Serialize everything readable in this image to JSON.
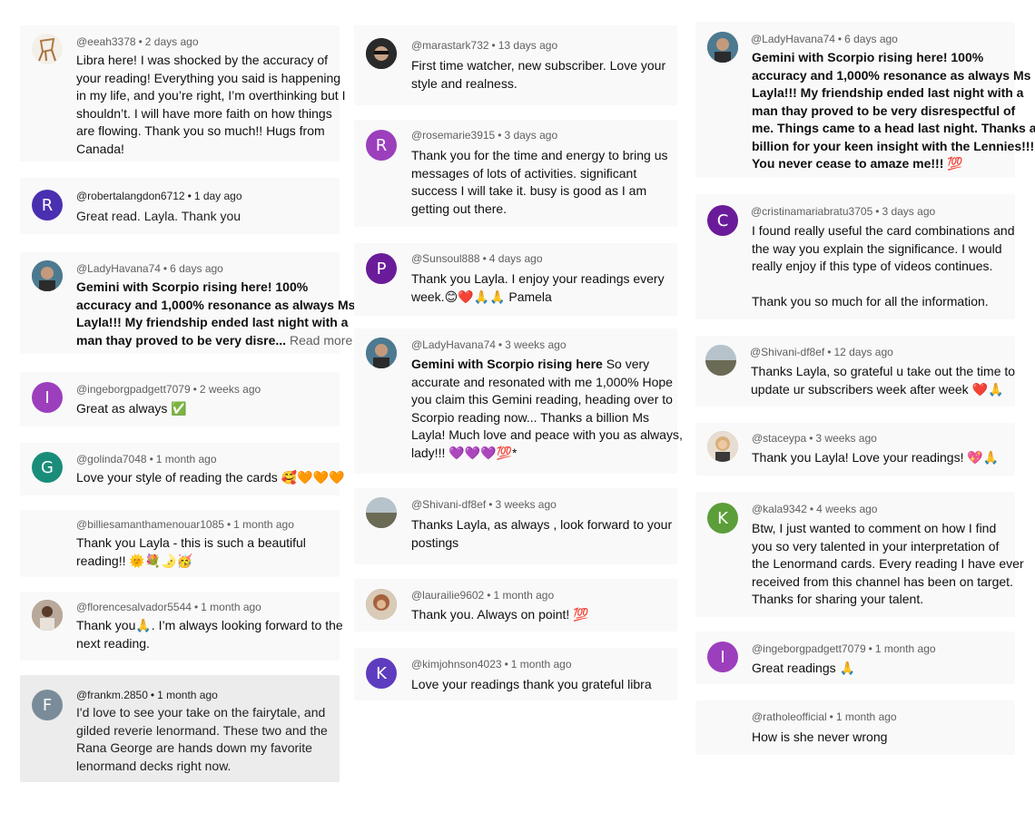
{
  "colors": {
    "purple": "#9c3fbd",
    "indigo": "#4a2fb0",
    "teal": "#1a8c7a",
    "green": "#5b9e3a",
    "slate": "#7a8c99",
    "meta": "#606060"
  },
  "comments": [
    {
      "user": "@eeah3378",
      "time": "2 days ago",
      "avatar": "chair-photo",
      "lines": [
        "Libra here! I was shocked by the accuracy of",
        "your reading! Everything you said is happening",
        "in my life, and you’re right, I’m overthinking but I",
        "shouldn’t. I will have more faith on how things",
        "are flowing. Thank you so much!! Hugs from",
        "Canada!"
      ]
    },
    {
      "user": "@robertalangdon6712",
      "time": "1 day ago",
      "avatar_letter": "R",
      "lines": [
        "Great read. Layla.  Thank you"
      ]
    },
    {
      "user": "@LadyHavana74",
      "time": "6 days ago",
      "avatar": "profile-photo",
      "lines": [
        "Gemini with Scorpio rising here! 100%",
        "accuracy and 1,000% resonance as always Ms",
        "Layla!!! My friendship ended last night with a",
        "man thay proved to be very disre..."
      ],
      "read_more": "Read more"
    },
    {
      "user": "@ingeborgpadgett7079",
      "time": "2 weeks ago",
      "avatar_letter": "I",
      "lines": [
        "Great as always ✅"
      ]
    },
    {
      "user": "@golinda7048",
      "time": "1 month ago",
      "avatar_letter": "G",
      "lines": [
        "Love your style of reading the cards 🥰🧡🧡🧡"
      ]
    },
    {
      "user": "@billiesamanthamenouar1085",
      "time": "1 month ago",
      "lines": [
        "Thank you Layla - this is such a beautiful",
        "reading!! 🌞💐🌛🥳"
      ]
    },
    {
      "user": "@florencesalvador5544",
      "time": "1 month ago",
      "avatar": "profile-photo",
      "lines": [
        "Thank you🙏. I’m always looking forward to the",
        "next reading."
      ]
    },
    {
      "user": "@frankm.2850",
      "time": "1 month ago",
      "avatar_letter": "F",
      "lines": [
        "I'd love to see your take on the fairytale, and",
        "gilded reverie lenormand. These two and the",
        "Rana George are hands down my favorite",
        "lenormand decks right now."
      ]
    },
    {
      "user": "@marastark732",
      "time": "13 days ago",
      "avatar": "profile-photo",
      "lines": [
        "First time watcher, new subscriber. Love your",
        "style and realness."
      ]
    },
    {
      "user": "@rosemarie3915",
      "time": "3 days ago",
      "avatar_letter": "R",
      "lines": [
        "Thank you for the time and energy to bring us",
        "messages of lots of activities.  significant",
        "success I will take it.  busy is good as I am",
        "getting out there."
      ]
    },
    {
      "user": "@Sunsoul888",
      "time": "4 days ago",
      "avatar_letter": "P",
      "lines": [
        "Thank you Layla. I enjoy your readings every",
        "week.😊❤️🙏🙏 Pamela"
      ]
    },
    {
      "user": "@LadyHavana74",
      "time": "3 weeks ago",
      "avatar": "profile-photo",
      "lead": "Gemini with Scorpio rising here",
      "lines": [
        " So very",
        "accurate and resonated with me 1,000% Hope",
        "you claim this Gemini reading, heading over to",
        "Scorpio reading now... Thanks a billion Ms",
        "Layla! Much love and peace with you as always,",
        "lady!!! 💜💜💜💯*"
      ]
    },
    {
      "user": "@Shivani-df8ef",
      "time": "3 weeks ago",
      "avatar": "landscape-photo",
      "lines": [
        "Thanks Layla, as always , look forward to your",
        "postings"
      ]
    },
    {
      "user": "@laurailie9602",
      "time": "1 month ago",
      "avatar": "profile-photo",
      "lines": [
        "Thank you. Always on point! 💯"
      ]
    },
    {
      "user": "@kimjohnson4023",
      "time": "1 month ago",
      "avatar_letter": "K",
      "lines": [
        "Love your readings thank you grateful libra"
      ]
    },
    {
      "user": "@LadyHavana74",
      "time": "6 days ago",
      "avatar": "profile-photo",
      "lines": [
        "Gemini with Scorpio rising here! 100%",
        "accuracy and 1,000% resonance as always Ms",
        "Layla!!! My friendship ended last night with a",
        "man thay proved to be very disrespectful of",
        "me. Things came to a head last night. Thanks a",
        "billion for your keen insight with the Lennies!!!",
        "You never cease to amaze me!!! 💯"
      ]
    },
    {
      "user": "@cristinamariabratu3705",
      "time": "3 days ago",
      "avatar_letter": "C",
      "lines": [
        "I found really useful the card combinations and",
        "the way you explain the significance. I would",
        "really enjoy if this type of videos continues.",
        "",
        "Thank you so much for all the information."
      ]
    },
    {
      "user": "@Shivani-df8ef",
      "time": "12 days ago",
      "avatar": "landscape-photo",
      "lines": [
        "Thanks Layla, so grateful u take out the time to",
        "update ur subscribers week after week ❤️🙏"
      ]
    },
    {
      "user": "@staceypa",
      "time": "3 weeks ago",
      "avatar": "profile-photo",
      "lines": [
        "Thank you Layla! Love your readings! 💖🙏"
      ]
    },
    {
      "user": "@kala9342",
      "time": "4 weeks ago",
      "avatar_letter": "K",
      "lines": [
        "Btw, I just wanted to comment on how I find",
        "you so very talented in your interpretation of",
        "the Lenormand cards. Every reading I have ever",
        "received from this channel has been on target.",
        "Thanks for sharing your talent."
      ]
    },
    {
      "user": "@ingeborgpadgett7079",
      "time": "1 month ago",
      "avatar_letter": "I",
      "lines": [
        "Great readings 🙏"
      ]
    },
    {
      "user": "@ratholeofficial",
      "time": "1 month ago",
      "lines": [
        "How is she never wrong"
      ]
    }
  ]
}
